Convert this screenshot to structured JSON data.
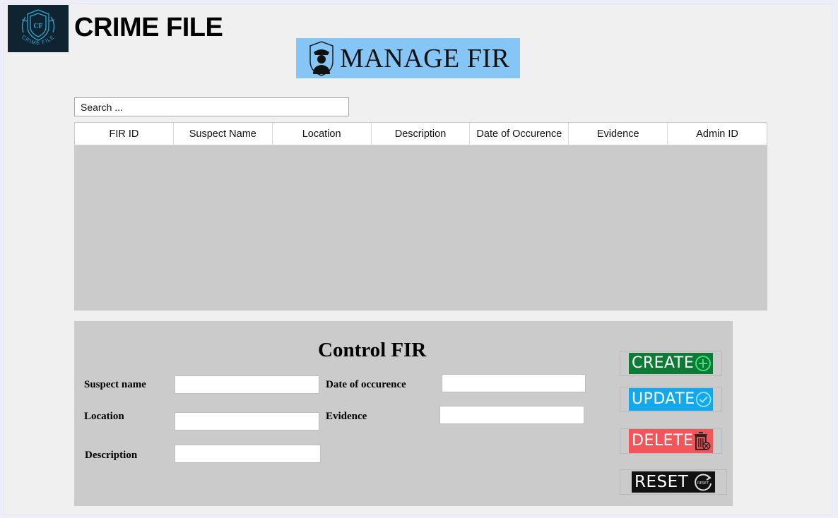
{
  "header": {
    "app_title": "CRIME FILE",
    "logo_text": "CRIME FILE",
    "banner_text": "MANAGE FIR"
  },
  "search": {
    "placeholder": "Search ..."
  },
  "table": {
    "columns": [
      "FIR ID",
      "Suspect Name",
      "Location",
      "Description",
      "Date of Occurence",
      "Evidence",
      "Admin ID"
    ],
    "rows": []
  },
  "control": {
    "title": "Control FIR",
    "labels": {
      "suspect_name": "Suspect name",
      "date_of_occurence": "Date of occurence",
      "location": "Location",
      "evidence": "Evidence",
      "description": "Description"
    },
    "values": {
      "suspect_name": "",
      "date_of_occurence": "",
      "location": "",
      "evidence": "",
      "description": ""
    }
  },
  "buttons": {
    "create": {
      "label": "CREATE",
      "color": "#0d7a36",
      "icon": "plus-circle-icon"
    },
    "update": {
      "label": "UPDATE",
      "color": "#13a8ea",
      "icon": "check-circle-icon"
    },
    "delete": {
      "label": "DELETE",
      "color": "#f2555a",
      "icon": "trash-icon"
    },
    "reset": {
      "label": "RESET",
      "color": "#111111",
      "icon": "reset-icon",
      "icon_text": "RESET"
    }
  },
  "colors": {
    "banner_bg": "#86c6f7",
    "panel_bg": "#cbcbcb",
    "logo_bg": "#0f2430"
  }
}
